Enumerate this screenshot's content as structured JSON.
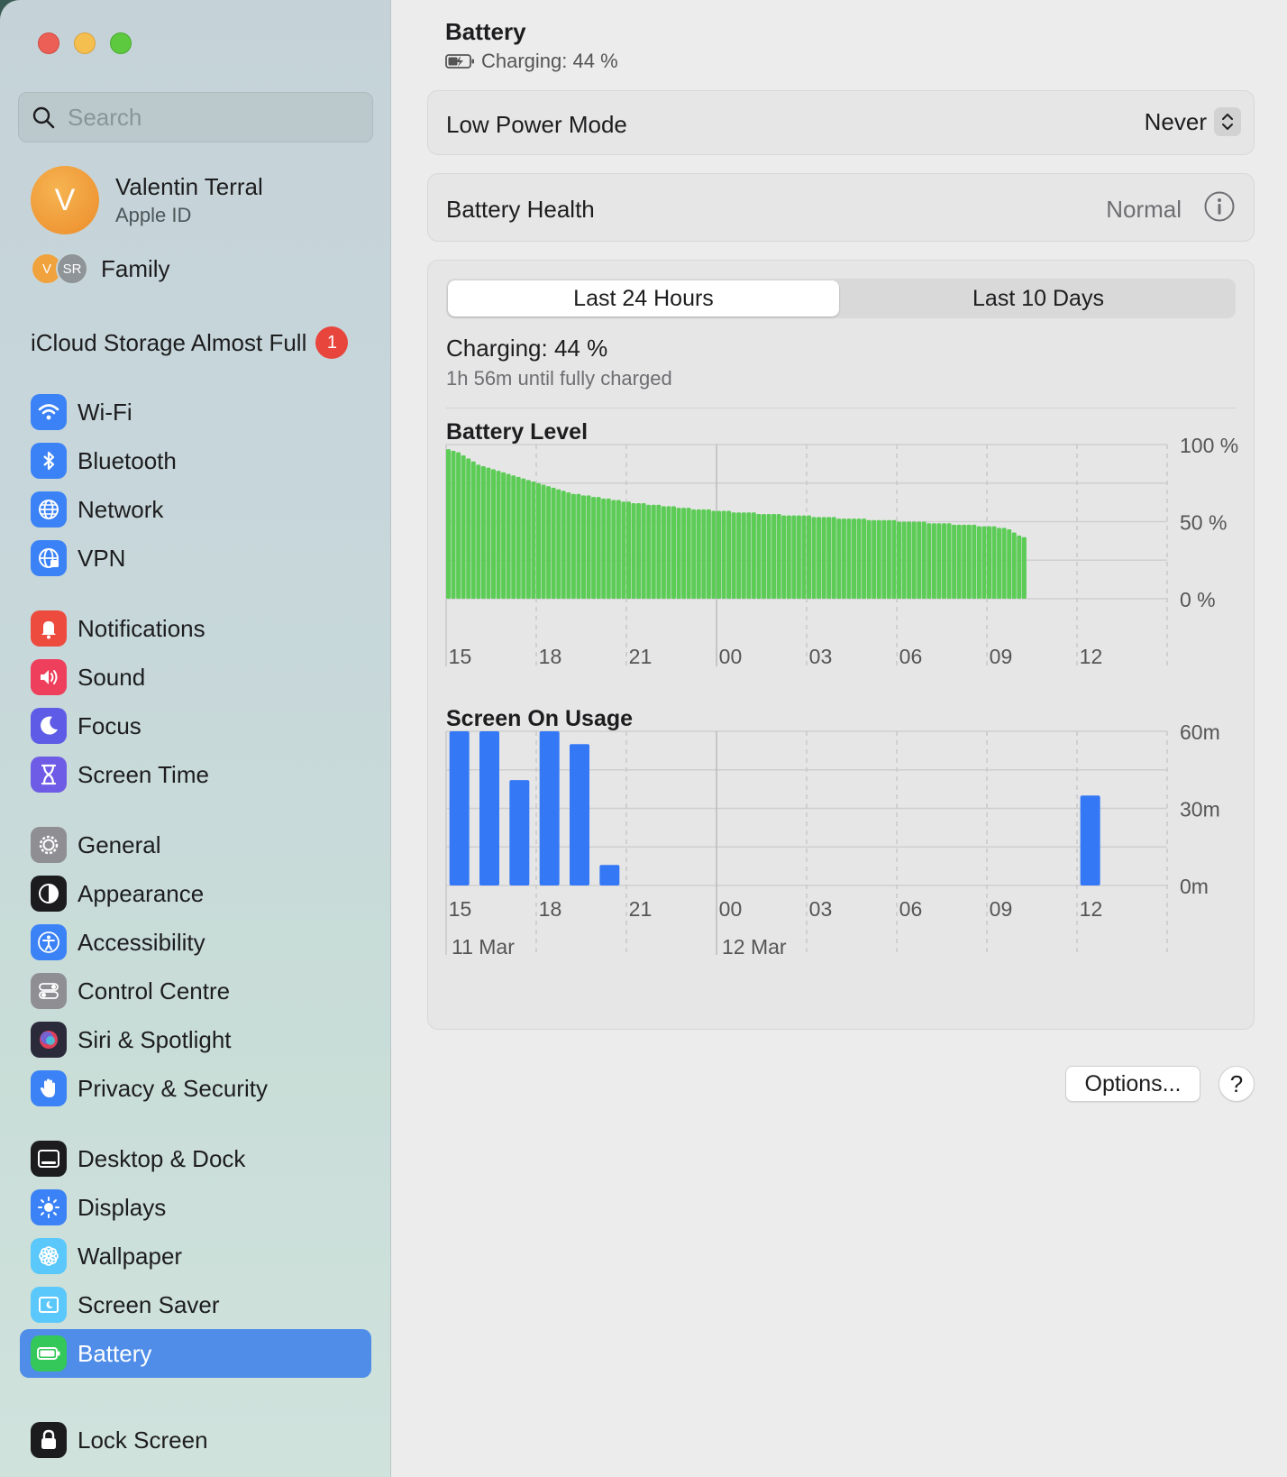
{
  "window": {
    "controls": [
      "close",
      "minimize",
      "zoom"
    ]
  },
  "sidebar": {
    "search": {
      "placeholder": "Search",
      "value": ""
    },
    "account": {
      "initial": "V",
      "name": "Valentin Terral",
      "subtitle": "Apple ID"
    },
    "family": {
      "avatars": [
        "V",
        "SR"
      ],
      "label": "Family"
    },
    "icloud": {
      "label": "iCloud Storage Almost Full",
      "badge": "1"
    },
    "items": [
      {
        "label": "Wi-Fi",
        "icon": "wifi-icon",
        "color": "#3b82f6"
      },
      {
        "label": "Bluetooth",
        "icon": "bluetooth-icon",
        "color": "#3b82f6"
      },
      {
        "label": "Network",
        "icon": "globe-icon",
        "color": "#3b82f6"
      },
      {
        "label": "VPN",
        "icon": "vpn-globe-icon",
        "color": "#3b82f6"
      },
      {
        "label": "Notifications",
        "icon": "bell-icon",
        "color": "#ee4b3f"
      },
      {
        "label": "Sound",
        "icon": "speaker-icon",
        "color": "#ee3f5c"
      },
      {
        "label": "Focus",
        "icon": "moon-icon",
        "color": "#5e5ce6"
      },
      {
        "label": "Screen Time",
        "icon": "hourglass-icon",
        "color": "#6e5ce6"
      },
      {
        "label": "General",
        "icon": "gear-icon",
        "color": "#8e8e93"
      },
      {
        "label": "Appearance",
        "icon": "appearance-icon",
        "color": "#1c1c1e"
      },
      {
        "label": "Accessibility",
        "icon": "accessibility-icon",
        "color": "#3b82f6"
      },
      {
        "label": "Control Centre",
        "icon": "toggles-icon",
        "color": "#8e8e93"
      },
      {
        "label": "Siri & Spotlight",
        "icon": "siri-icon",
        "color": "#2a2a3a"
      },
      {
        "label": "Privacy & Security",
        "icon": "hand-icon",
        "color": "#3b82f6"
      },
      {
        "label": "Desktop & Dock",
        "icon": "dock-icon",
        "color": "#1c1c1e"
      },
      {
        "label": "Displays",
        "icon": "sun-icon",
        "color": "#3b82f6"
      },
      {
        "label": "Wallpaper",
        "icon": "flower-icon",
        "color": "#5ac8fa"
      },
      {
        "label": "Screen Saver",
        "icon": "screensaver-icon",
        "color": "#5ac8fa"
      },
      {
        "label": "Battery",
        "icon": "battery-icon",
        "color": "#34c759",
        "active": true
      },
      {
        "label": "Lock Screen",
        "icon": "lock-icon",
        "color": "#1c1c1e"
      }
    ],
    "active_color": "#4f8de8"
  },
  "header": {
    "title": "Battery",
    "status": "Charging: 44 %"
  },
  "low_power_mode": {
    "label": "Low Power Mode",
    "value": "Never"
  },
  "battery_health": {
    "label": "Battery Health",
    "value": "Normal"
  },
  "usage": {
    "tabs": [
      {
        "label": "Last 24 Hours",
        "selected": true
      },
      {
        "label": "Last 10 Days",
        "selected": false
      }
    ],
    "status": "Charging: 44 %",
    "eta": "1h 56m until fully charged"
  },
  "chart_data": [
    {
      "type": "bar",
      "title": "Battery Level",
      "color": "#5ccc57",
      "x_ticks": [
        "15",
        "18",
        "21",
        "00",
        "03",
        "06",
        "09",
        "12"
      ],
      "y_ticks": [
        "100 %",
        "50 %",
        "0 %"
      ],
      "ylim": [
        0,
        100
      ],
      "x_range_hours": [
        14.5,
        38.5
      ],
      "interval_minutes": 10,
      "values": [
        97,
        96,
        95,
        93,
        91,
        89,
        87,
        86,
        85,
        84,
        83,
        82,
        81,
        80,
        79,
        78,
        77,
        76,
        75,
        74,
        73,
        72,
        71,
        70,
        69,
        68,
        68,
        67,
        67,
        66,
        66,
        65,
        65,
        64,
        64,
        63,
        63,
        62,
        62,
        62,
        61,
        61,
        61,
        60,
        60,
        60,
        59,
        59,
        59,
        58,
        58,
        58,
        58,
        57,
        57,
        57,
        57,
        56,
        56,
        56,
        56,
        56,
        55,
        55,
        55,
        55,
        55,
        54,
        54,
        54,
        54,
        54,
        54,
        53,
        53,
        53,
        53,
        53,
        52,
        52,
        52,
        52,
        52,
        52,
        51,
        51,
        51,
        51,
        51,
        51,
        50,
        50,
        50,
        50,
        50,
        50,
        49,
        49,
        49,
        49,
        49,
        48,
        48,
        48,
        48,
        48,
        47,
        47,
        47,
        47,
        46,
        46,
        45,
        43,
        41,
        40
      ]
    },
    {
      "type": "bar",
      "title": "Screen On Usage",
      "color": "#3478f6",
      "x_ticks": [
        "15",
        "18",
        "21",
        "00",
        "03",
        "06",
        "09",
        "12"
      ],
      "date_labels": [
        "11 Mar",
        "12 Mar"
      ],
      "y_ticks": [
        "60m",
        "30m",
        "0m"
      ],
      "ylim": [
        0,
        60
      ],
      "x_range_hours": [
        14.5,
        38.5
      ],
      "hours": [
        15,
        16,
        17,
        18,
        19,
        20,
        36
      ],
      "values": [
        60,
        60,
        41,
        60,
        55,
        8,
        35
      ]
    }
  ],
  "buttons": {
    "options": "Options...",
    "help": "?"
  }
}
